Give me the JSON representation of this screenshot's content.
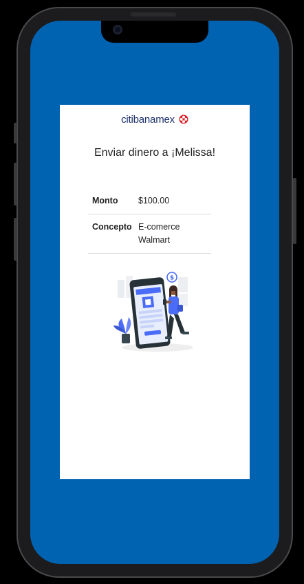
{
  "brand": {
    "name": "citibanamex",
    "logo_color": "#1a2f6b",
    "accent_color": "#d8232a"
  },
  "screen": {
    "background_color": "#0063b1"
  },
  "transfer": {
    "title": "Enviar dinero a ¡Melissa!",
    "amount_label": "Monto",
    "amount_value": "$100.00",
    "concept_label": "Concepto",
    "concept_value_line1": "E-comerce",
    "concept_value_line2": "Walmart"
  },
  "illustration": {
    "icon": "mobile-payment-illustration",
    "badge_glyph": "$"
  }
}
